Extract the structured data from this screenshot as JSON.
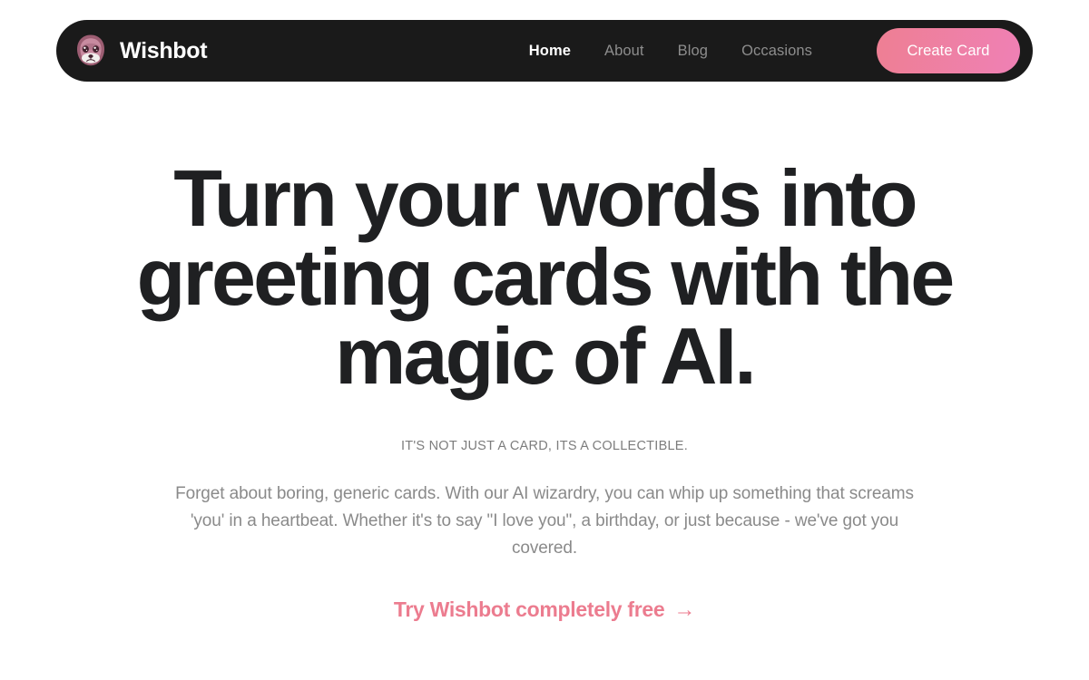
{
  "brand": {
    "name": "Wishbot",
    "logo_icon": "robot-face-icon"
  },
  "nav": {
    "items": [
      {
        "label": "Home",
        "active": true
      },
      {
        "label": "About",
        "active": false
      },
      {
        "label": "Blog",
        "active": false
      },
      {
        "label": "Occasions",
        "active": false
      }
    ],
    "cta_label": "Create Card"
  },
  "hero": {
    "headline": "Turn your words into greeting cards with the magic of AI.",
    "eyebrow": "IT'S NOT JUST A CARD, ITS A COLLECTIBLE.",
    "lede": "Forget about boring, generic cards. With our AI wizardry, you can whip up something that screams 'you' in a heartbeat. Whether it's to say \"I love you\", a birthday, or just because - we've got you covered.",
    "free_link_label": "Try Wishbot completely free",
    "free_link_arrow": "→"
  },
  "colors": {
    "page_background": "#ffffff",
    "navbar_background": "#1a1a1a",
    "cta_gradient_start": "#ee7f93",
    "cta_gradient_end": "#ef80b5",
    "accent_pink": "#ec7c8f",
    "headline": "#1f2022",
    "muted_text": "#8a8a8a",
    "nav_inactive": "#8d8d8d"
  }
}
